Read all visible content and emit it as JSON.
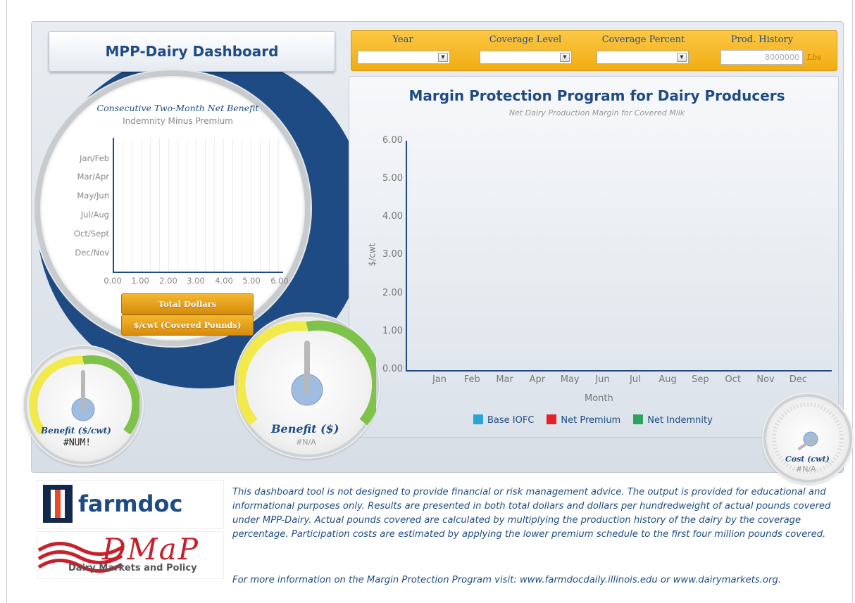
{
  "dashboard_title": "MPP-Dairy Dashboard",
  "filters": {
    "year_label": "Year",
    "coverage_level_label": "Coverage Level",
    "coverage_percent_label": "Coverage Percent",
    "prod_history_label": "Prod. History",
    "prod_history_value": "8000000",
    "prod_history_unit": "Lbs"
  },
  "left_chart": {
    "title": "Consecutive Two-Month Net Benefit",
    "subtitle": "Indemnity Minus Premium",
    "y_categories": [
      "Jan/Feb",
      "Mar/Apr",
      "May/Jun",
      "Jul/Aug",
      "Oct/Sept",
      "Dec/Nov"
    ],
    "x_ticks": [
      "0.00",
      "1.00",
      "2.00",
      "3.00",
      "4.00",
      "5.00",
      "6.00"
    ],
    "btn_total": "Total Dollars",
    "btn_cwt": "$/cwt (Covered Pounds)"
  },
  "chart_data": {
    "type": "bar",
    "title": "Margin Protection Program for Dairy Producers",
    "subtitle": "Net Dairy Production Margin for Covered Milk",
    "xlabel": "Month",
    "ylabel": "$/cwt",
    "categories": [
      "Jan",
      "Feb",
      "Mar",
      "Apr",
      "May",
      "Jun",
      "Jul",
      "Aug",
      "Sep",
      "Oct",
      "Nov",
      "Dec"
    ],
    "y_ticks": [
      "6.00",
      "5.00",
      "4.00",
      "3.00",
      "2.00",
      "1.00",
      "0.00"
    ],
    "ylim": [
      0,
      6
    ],
    "series": [
      {
        "name": "Base IOFC",
        "color": "#2aa3db",
        "values": []
      },
      {
        "name": "Net Premium",
        "color": "#e62129",
        "values": []
      },
      {
        "name": "Net Indemnity",
        "color": "#2ea35f",
        "values": []
      }
    ],
    "legend_position": "bottom"
  },
  "gauges": {
    "benefit_cwt_label": "Benefit ($/cwt)",
    "benefit_cwt_value": "#NUM!",
    "benefit_label": "Benefit ($)",
    "benefit_value": "#N/A",
    "cost_label": "Cost (cwt)",
    "cost_value": "#N/A"
  },
  "footer": {
    "disclaimer": "This dashboard tool is not designed to provide financial or risk management advice. The output is provided for educational and informational purposes only. Results are presented in both total dollars and dollars per hundredweight of actual pounds covered under MPP-Dairy. Actual pounds covered are calculated by multiplying the production history of the dairy by the coverage percentage. Participation costs are estimated by applying the lower premium schedule to the first four million pounds covered.",
    "more_info": "For more information on the Margin Protection Program visit: www.farmdocdaily.illinois.edu or www.dairymarkets.org.",
    "logo_farmdoc_text": "farmdoc",
    "logo_dmap_text": "DMaP",
    "logo_dmap_sub": "Dairy Markets and Policy"
  }
}
